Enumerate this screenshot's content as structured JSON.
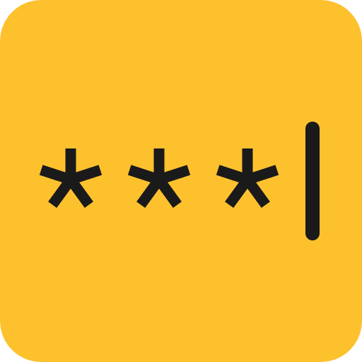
{
  "icon": {
    "name": "password-field-icon",
    "background_color": "#FDC12E",
    "glyph_color": "#1A1A1A",
    "masked_characters": [
      "*",
      "*",
      "*"
    ],
    "cursor_icon": "text-cursor-icon"
  }
}
